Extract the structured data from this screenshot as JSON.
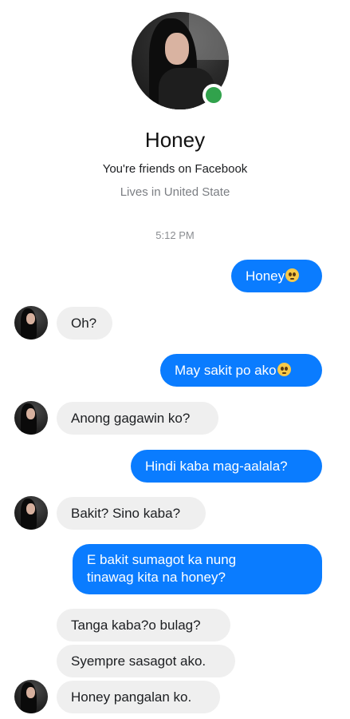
{
  "profile": {
    "name": "Honey",
    "friends_text": "You're friends on Facebook",
    "lives_text": "Lives in United State",
    "online_status_color": "#31a24c"
  },
  "conversation": {
    "timestamp": "5:12 PM",
    "messages": [
      {
        "from": "me",
        "text": "Honey",
        "emoji": "pleading-face"
      },
      {
        "from": "them",
        "text": "Oh?"
      },
      {
        "from": "me",
        "text": "May sakit po ako",
        "emoji": "pleading-face"
      },
      {
        "from": "them",
        "text": "Anong gagawin ko?"
      },
      {
        "from": "me",
        "text": "Hindi kaba mag-aalala?"
      },
      {
        "from": "them",
        "text": "Bakit? Sino kaba?"
      },
      {
        "from": "me",
        "lines": [
          "E bakit sumagot ka nung",
          "tinawag kita na honey?"
        ]
      },
      {
        "from": "them",
        "text": "Tanga kaba?o bulag?"
      },
      {
        "from": "them",
        "text": "Syempre sasagot ako."
      },
      {
        "from": "them",
        "text": "Honey pangalan ko."
      }
    ]
  },
  "colors": {
    "sent_bubble": "#0a7cff",
    "received_bubble": "#efefef"
  }
}
